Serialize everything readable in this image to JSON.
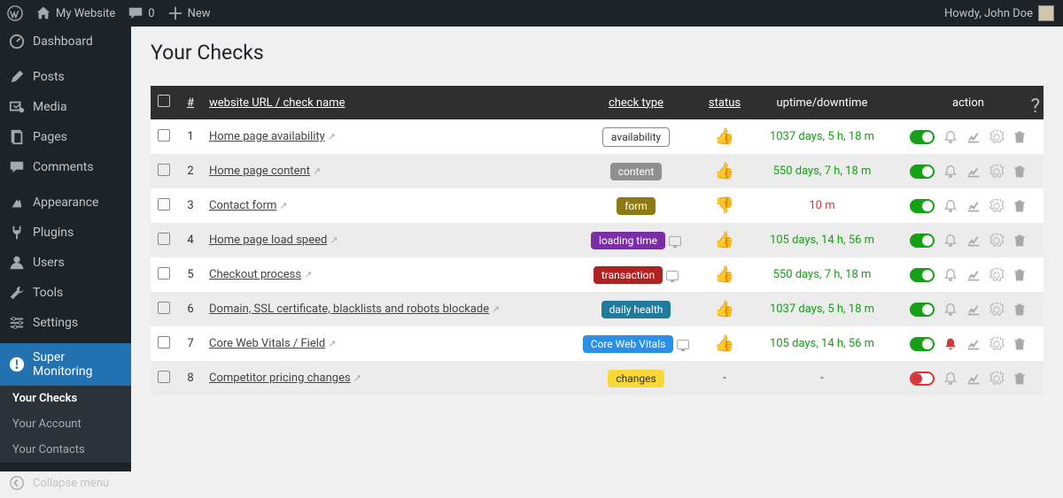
{
  "topbar": {
    "site_name": "My Website",
    "comment_count": "0",
    "new_label": "New",
    "howdy": "Howdy, John Doe"
  },
  "sidebar": {
    "items": [
      {
        "label": "Dashboard"
      },
      {
        "label": "Posts"
      },
      {
        "label": "Media"
      },
      {
        "label": "Pages"
      },
      {
        "label": "Comments"
      },
      {
        "label": "Appearance"
      },
      {
        "label": "Plugins"
      },
      {
        "label": "Users"
      },
      {
        "label": "Tools"
      },
      {
        "label": "Settings"
      },
      {
        "label": "Super Monitoring"
      }
    ],
    "submenu": [
      "Your Checks",
      "Your Account",
      "Your Contacts"
    ],
    "collapse": "Collapse menu"
  },
  "page": {
    "title": "Your Checks",
    "columns": {
      "num": "#",
      "name": "website URL / check name",
      "type": "check type",
      "status": "status",
      "uptime": "uptime/downtime",
      "action": "action"
    }
  },
  "badges": {
    "availability": {
      "bg": "#ffffff",
      "fg": "#333",
      "outline": true
    },
    "content": {
      "bg": "#8f8f8f"
    },
    "form": {
      "bg": "#8e7a12"
    },
    "loading time": {
      "bg": "#7b2ea5",
      "mon": true
    },
    "transaction": {
      "bg": "#b02121",
      "mon": true
    },
    "daily health": {
      "bg": "#1f7a9b"
    },
    "Core Web Vitals": {
      "bg": "#2a8fe6",
      "mon": true
    },
    "changes": {
      "bg": "#f7d837",
      "fg": "#333"
    }
  },
  "rows": [
    {
      "n": "1",
      "name": "Home page availability",
      "type": "availability",
      "status": "up",
      "uptime": "1037 days, 5 h, 18 m",
      "enabled": true,
      "alert": false
    },
    {
      "n": "2",
      "name": "Home page content",
      "type": "content",
      "status": "up",
      "uptime": "550 days, 7 h, 18 m",
      "enabled": true,
      "alert": false
    },
    {
      "n": "3",
      "name": "Contact form",
      "type": "form",
      "status": "down",
      "uptime": "10 m",
      "enabled": true,
      "alert": false
    },
    {
      "n": "4",
      "name": "Home page load speed",
      "type": "loading time",
      "status": "up",
      "uptime": "105 days, 14 h, 56 m",
      "enabled": true,
      "alert": false
    },
    {
      "n": "5",
      "name": "Checkout process",
      "type": "transaction",
      "status": "up",
      "uptime": "550 days, 7 h, 18 m",
      "enabled": true,
      "alert": false
    },
    {
      "n": "6",
      "name": "Domain, SSL certificate, blacklists and robots blockade",
      "type": "daily health",
      "status": "up",
      "uptime": "1037 days, 5 h, 18 m",
      "enabled": true,
      "alert": false
    },
    {
      "n": "7",
      "name": "Core Web Vitals / Field",
      "type": "Core Web Vitals",
      "status": "up",
      "uptime": "105 days, 14 h, 56 m",
      "enabled": true,
      "alert": true
    },
    {
      "n": "8",
      "name": "Competitor pricing changes",
      "type": "changes",
      "status": "-",
      "uptime": "-",
      "enabled": false,
      "alert": false
    }
  ]
}
